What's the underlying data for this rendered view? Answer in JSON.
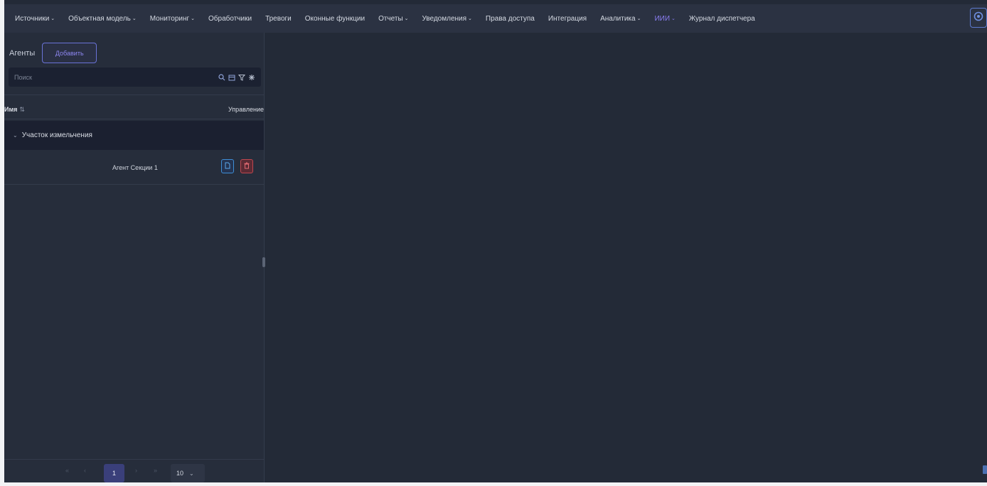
{
  "nav": {
    "items": [
      {
        "label": "Источники",
        "dropdown": true,
        "active": false
      },
      {
        "label": "Объектная модель",
        "dropdown": true,
        "active": false
      },
      {
        "label": "Мониторинг",
        "dropdown": true,
        "active": false
      },
      {
        "label": "Обработчики",
        "dropdown": false,
        "active": false
      },
      {
        "label": "Тревоги",
        "dropdown": false,
        "active": false
      },
      {
        "label": "Оконные функции",
        "dropdown": false,
        "active": false
      },
      {
        "label": "Отчеты",
        "dropdown": true,
        "active": false
      },
      {
        "label": "Уведомления",
        "dropdown": true,
        "active": false
      },
      {
        "label": "Права доступа",
        "dropdown": false,
        "active": false
      },
      {
        "label": "Интеграция",
        "dropdown": false,
        "active": false
      },
      {
        "label": "Аналитика",
        "dropdown": true,
        "active": false
      },
      {
        "label": "ИИИ",
        "dropdown": true,
        "active": true
      },
      {
        "label": "Журнал диспетчера",
        "dropdown": false,
        "active": false
      }
    ],
    "settings_icon": "settings-icon"
  },
  "panel": {
    "title": "Агенты",
    "add_label": "Добавить",
    "search_placeholder": "Поиск"
  },
  "table": {
    "col_name": "Имя",
    "col_control": "Управление",
    "groups": [
      {
        "name": "Участок измельчения",
        "expanded": true,
        "rows": [
          {
            "name": "Агент Секции 1"
          }
        ]
      }
    ]
  },
  "pagination": {
    "current_page": "1",
    "page_size": "10"
  },
  "colors": {
    "accent": "#8a7df2",
    "edit": "#3f8fd8",
    "delete": "#c0474f",
    "background": "#232a37"
  }
}
